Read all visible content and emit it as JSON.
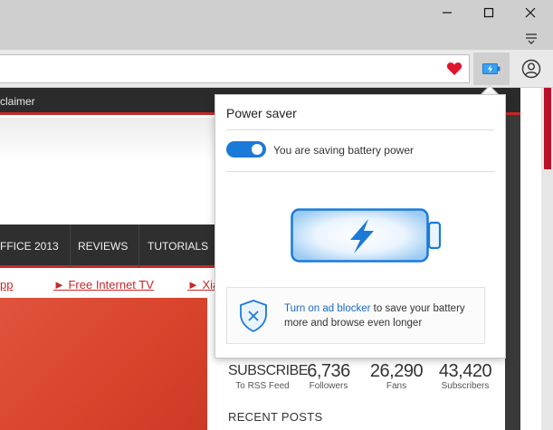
{
  "window": {
    "minimize_glyph": "—",
    "maximize_glyph": "☐",
    "close_glyph": "✕"
  },
  "toolbar": {
    "icons": [
      "heart-icon",
      "battery-icon",
      "profile-icon",
      "menu-icon"
    ]
  },
  "site": {
    "topnav_text": "claimer",
    "mainnav": [
      "FFICE 2013",
      "REVIEWS",
      "TUTORIALS"
    ],
    "links": [
      "pp",
      "► Free Internet TV",
      "► Xia"
    ],
    "stats": [
      {
        "value": "SUBSCRIBE",
        "label": "To RSS Feed"
      },
      {
        "value": "6,736",
        "label": "Followers"
      },
      {
        "value": "26,290",
        "label": "Fans"
      },
      {
        "value": "43,420",
        "label": "Subscribers"
      }
    ],
    "recent_posts": "RECENT POSTS"
  },
  "popup": {
    "title": "Power saver",
    "toggle_on": true,
    "toggle_label": "You are saving battery power",
    "ad_link": "Turn on ad blocker",
    "ad_text": " to save your battery more and browse even longer"
  },
  "colors": {
    "accent": "#1b7ad8",
    "site_red": "#c62828",
    "heart": "#e0142c"
  }
}
